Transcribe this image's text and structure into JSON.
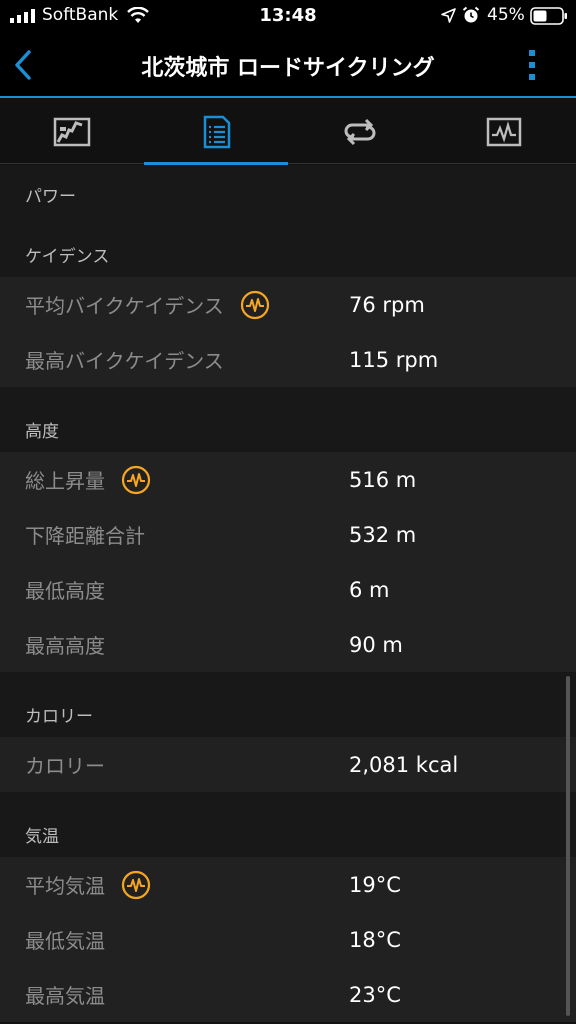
{
  "status_bar": {
    "carrier": "SoftBank",
    "time": "13:48",
    "battery_percent": "45%"
  },
  "nav": {
    "title": "北茨城市 ロードサイクリング"
  },
  "tabs": [
    {
      "icon": "map-icon",
      "active": false
    },
    {
      "icon": "list-details-icon",
      "active": true
    },
    {
      "icon": "loop-icon",
      "active": false
    },
    {
      "icon": "chart-icon",
      "active": false
    }
  ],
  "sections": {
    "power": {
      "header": "パワー"
    },
    "cadence": {
      "header": "ケイデンス",
      "rows": [
        {
          "label": "平均バイクケイデンス",
          "value": "76 rpm",
          "badge": true
        },
        {
          "label": "最高バイクケイデンス",
          "value": "115 rpm",
          "badge": false
        }
      ]
    },
    "elevation": {
      "header": "高度",
      "rows": [
        {
          "label": "総上昇量",
          "value": "516 m",
          "badge": true
        },
        {
          "label": "下降距離合計",
          "value": "532 m",
          "badge": false
        },
        {
          "label": "最低高度",
          "value": "6 m",
          "badge": false
        },
        {
          "label": "最高高度",
          "value": "90 m",
          "badge": false
        }
      ]
    },
    "calories": {
      "header": "カロリー",
      "rows": [
        {
          "label": "カロリー",
          "value": "2,081 kcal",
          "badge": false
        }
      ]
    },
    "temperature": {
      "header": "気温",
      "rows": [
        {
          "label": "平均気温",
          "value": "19°C",
          "badge": true
        },
        {
          "label": "最低気温",
          "value": "18°C",
          "badge": false
        },
        {
          "label": "最高気温",
          "value": "23°C",
          "badge": false
        }
      ]
    }
  },
  "colors": {
    "accent": "#1a8fd6",
    "badge": "#f5a623",
    "row_bg": "#212121",
    "section_bg": "#181818"
  }
}
